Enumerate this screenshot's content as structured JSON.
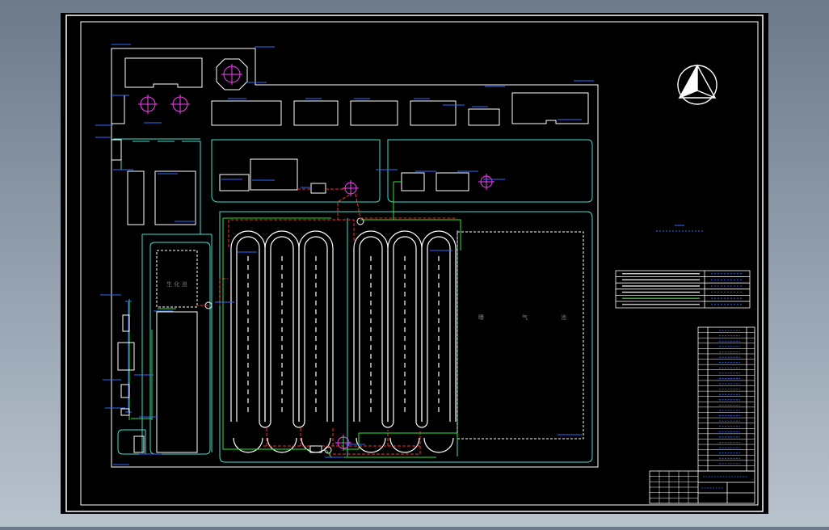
{
  "drawing": {
    "north_symbol": "north-arrow",
    "colors": {
      "background": "#000000",
      "frame": "#ffffff",
      "road": "#40e0d0",
      "building": "#ffffff",
      "leader": "#2f6bff",
      "sludge_line": "#ff2a2a",
      "water_line": "#2ee62e",
      "equipment": "#ff3cff",
      "text_yellow": "#ffd400"
    },
    "labels": {
      "left_building_a": "生 化 池",
      "main_tank_a": "曝",
      "main_tank_b": "气",
      "main_tank_c": "池"
    }
  }
}
